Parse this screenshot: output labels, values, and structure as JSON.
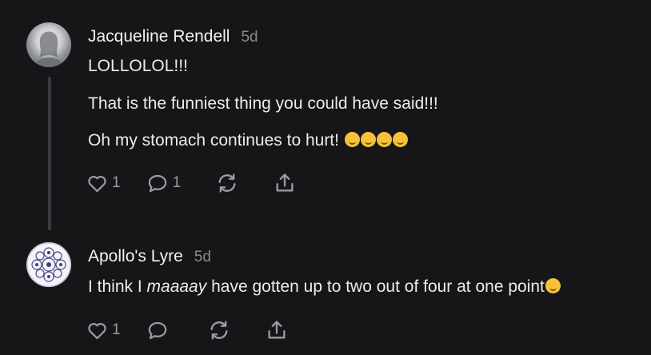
{
  "comments": [
    {
      "author": "Jacqueline Rendell",
      "time": "5d",
      "lines": [
        "LOLLOLOL!!!",
        "That is the funniest thing you could have said!!!",
        "Oh my stomach continues to hurt!"
      ],
      "emoji_count": 4,
      "likes": "1",
      "replies": "1"
    },
    {
      "author": "Apollo's Lyre",
      "time": "5d",
      "text_before": "I think I ",
      "text_em": "maaaay",
      "text_after": " have gotten up to two out of four at one point",
      "likes": "1"
    }
  ],
  "icons": {
    "like": "heart-icon",
    "reply": "comment-bubble-icon",
    "restack": "restack-icon",
    "share": "share-icon"
  }
}
